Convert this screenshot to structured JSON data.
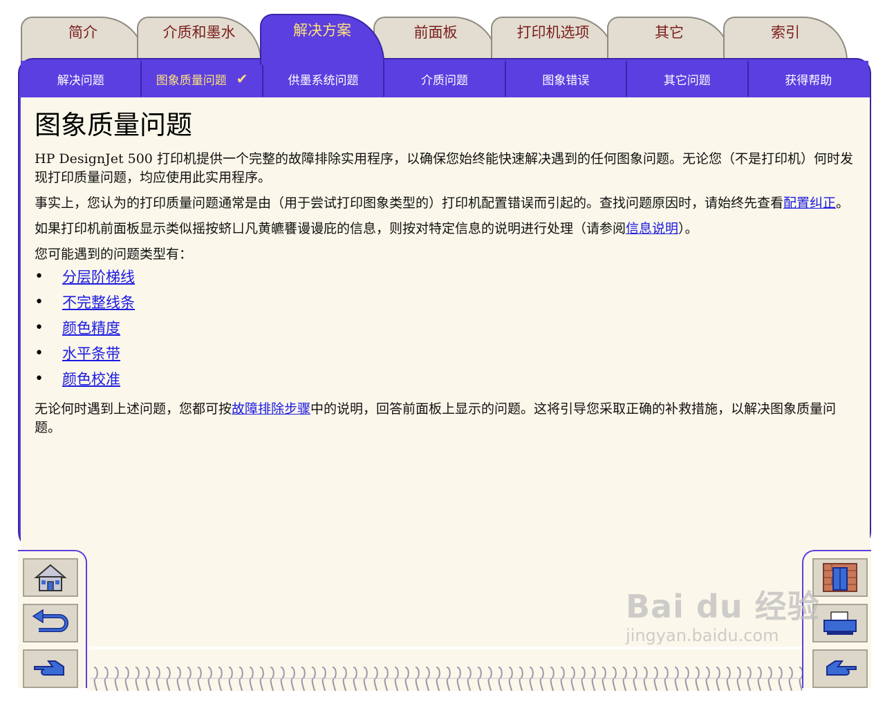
{
  "tabs": [
    {
      "label": "简介"
    },
    {
      "label": "介质和墨水"
    },
    {
      "label": "解决方案"
    },
    {
      "label": "前面板"
    },
    {
      "label": "打印机选项"
    },
    {
      "label": "其它"
    },
    {
      "label": "索引"
    }
  ],
  "active_tab": "解决方案",
  "subnav": [
    {
      "label": "解决问题"
    },
    {
      "label": "图象质量问题"
    },
    {
      "label": "供墨系统问题"
    },
    {
      "label": "介质问题"
    },
    {
      "label": "图象错误"
    },
    {
      "label": "其它问题"
    },
    {
      "label": "获得帮助"
    }
  ],
  "subnav_check": "✔",
  "page": {
    "title": "图象质量问题",
    "p1": "HP DesignJet 500 打印机提供一个完整的故障排除实用程序，以确保您始终能快速解决遇到的任何图象问题。无论您（不是打印机）何时发现打印质量问题，均应使用此实用程序。",
    "p2_before": "事实上，您认为的打印质量问题通常是由（用于尝试打印图象类型的）打印机配置错误而引起的。查找问题原因时，请始终先查看",
    "p2_link": "配置纠正",
    "p2_after": "。",
    "p3_before": "如果打印机前面板显示类似摇按蛴ㄩ凡黄皫饔谩谩庇的信息，则按对特定信息的说明进行处理（请参阅",
    "p3_link": "信息说明",
    "p3_after": "）。",
    "p4": "您可能遇到的问题类型有：",
    "problems": [
      "分层阶梯线",
      "不完整线条",
      "颜色精度",
      "水平条带",
      "颜色校准"
    ],
    "p5_before": "无论何时遇到上述问题，您都可按",
    "p5_link": "故障排除步骤",
    "p5_after": "中的说明，回答前面板上显示的问题。这将引导您采取正确的补救措施，以解决图象质量问题。"
  },
  "nav_buttons": {
    "left": [
      "home-icon",
      "back-icon",
      "next-icon"
    ],
    "right": [
      "exit-door-icon",
      "printer-icon",
      "forward-icon"
    ]
  },
  "watermark": {
    "main": "Bai du 经验",
    "sub": "jingyan.baidu.com"
  },
  "colors": {
    "frame": "#5b3fe0",
    "content_bg": "#fbf7ea",
    "tab_bg": "#e2ddd0",
    "tab_text": "#7a1c1c",
    "active_text": "#ffe27a",
    "link": "#1a1ae0"
  }
}
